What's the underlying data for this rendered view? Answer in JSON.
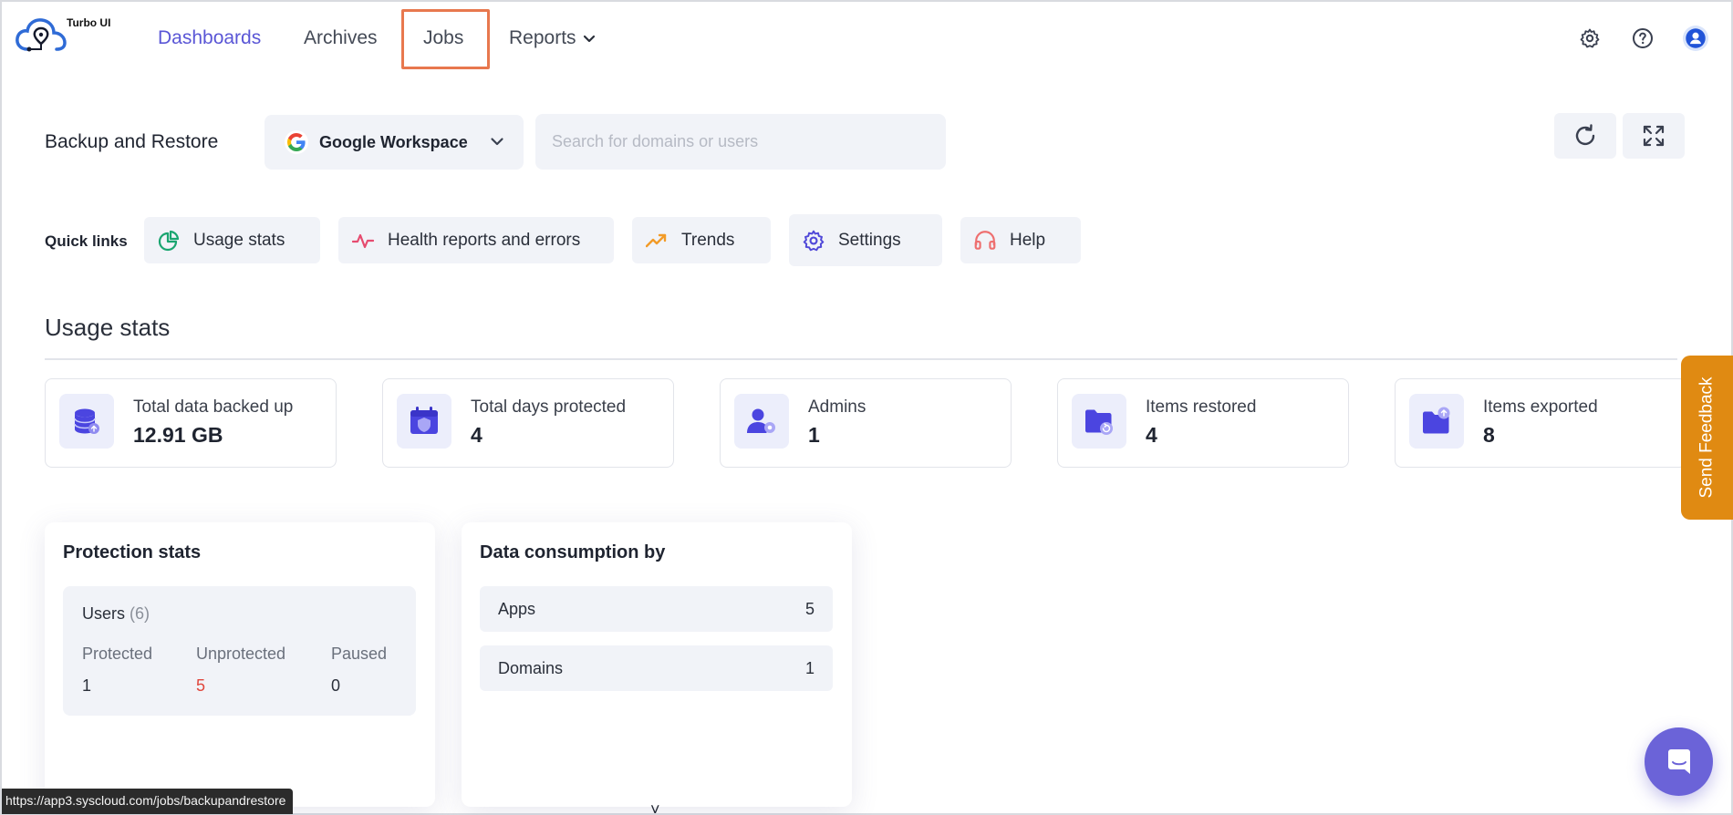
{
  "app": {
    "logo_text": "Turbo UI",
    "accent_color": "#5a56d6",
    "highlight_color": "#e8784e"
  },
  "nav": {
    "items": [
      {
        "label": "Dashboards"
      },
      {
        "label": "Archives"
      },
      {
        "label": "Jobs"
      },
      {
        "label": "Reports"
      }
    ],
    "right_icons": [
      "gear-icon",
      "help-icon",
      "user-icon"
    ]
  },
  "header": {
    "title": "Backup and Restore",
    "workspace": {
      "label": "Google Workspace",
      "icon": "google-icon"
    },
    "search": {
      "placeholder": "Search for domains or users",
      "value": ""
    },
    "actions": [
      "refresh-icon",
      "expand-icon"
    ]
  },
  "quick_links": {
    "label": "Quick links",
    "items": [
      {
        "label": "Usage stats",
        "icon": "pie-chart-icon"
      },
      {
        "label": "Health reports and errors",
        "icon": "pulse-icon"
      },
      {
        "label": "Trends",
        "icon": "trend-icon"
      },
      {
        "label": "Settings",
        "icon": "gear-icon"
      },
      {
        "label": "Help",
        "icon": "headphones-icon"
      }
    ]
  },
  "usage_stats": {
    "title": "Usage stats",
    "cards": [
      {
        "label": "Total data backed up",
        "value": "12.91 GB",
        "icon": "database-icon"
      },
      {
        "label": "Total days protected",
        "value": "4",
        "icon": "calendar-shield-icon"
      },
      {
        "label": "Admins",
        "value": "1",
        "icon": "admin-icon"
      },
      {
        "label": "Items restored",
        "value": "4",
        "icon": "folder-restore-icon"
      },
      {
        "label": "Items exported",
        "value": "8",
        "icon": "folder-export-icon"
      }
    ]
  },
  "protection_stats": {
    "title": "Protection stats",
    "users_label": "Users",
    "users_count": "(6)",
    "columns": [
      {
        "label": "Protected",
        "value": "1"
      },
      {
        "label": "Unprotected",
        "value": "5"
      },
      {
        "label": "Paused",
        "value": "0"
      }
    ]
  },
  "data_consumption": {
    "title": "Data consumption by",
    "rows": [
      {
        "label": "Apps",
        "value": "5"
      },
      {
        "label": "Domains",
        "value": "1"
      }
    ]
  },
  "feedback": {
    "label": "Send Feedback"
  },
  "status_url": "https://app3.syscloud.com/jobs/backupandrestore"
}
